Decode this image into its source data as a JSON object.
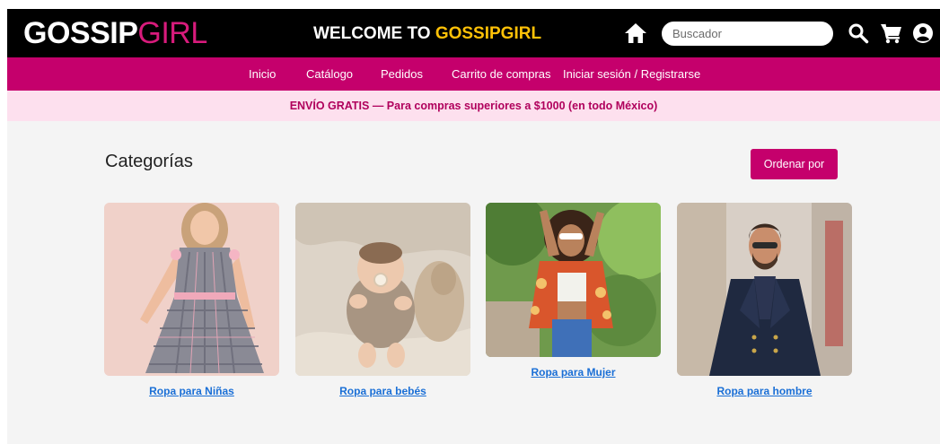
{
  "header": {
    "logo_part1": "GOSSIP",
    "logo_part2": "GIRL",
    "welcome_prefix": "WELCOME TO ",
    "welcome_brand": "GOSSIPGIRL",
    "search_placeholder": "Buscador",
    "icons": [
      "home-icon",
      "search-icon",
      "cart-icon",
      "user-icon"
    ]
  },
  "nav": {
    "items": [
      "Inicio",
      "Catálogo",
      "Pedidos",
      "Carrito de compras",
      "Iniciar sesión / Registrarse"
    ]
  },
  "promo": {
    "text": "ENVÍO GRATIS — Para compras superiores a $1000 (en todo México)"
  },
  "main": {
    "title": "Categorías",
    "sort_label": "Ordenar por",
    "categories": [
      {
        "label": "Ropa para Niñas"
      },
      {
        "label": "Ropa para bebés"
      },
      {
        "label": "Ropa para Mujer"
      },
      {
        "label": "Ropa para hombre"
      }
    ]
  },
  "colors": {
    "topbar": "#000000",
    "brand_pink": "#c5006c",
    "promo_bg": "#fde0ee",
    "welcome_highlight": "#ffc107",
    "link": "#1a6fd6"
  }
}
